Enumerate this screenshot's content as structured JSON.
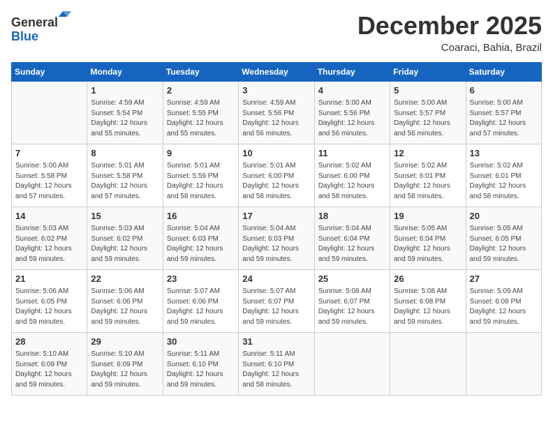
{
  "header": {
    "logo_line1": "General",
    "logo_line2": "Blue",
    "month": "December 2025",
    "location": "Coaraci, Bahia, Brazil"
  },
  "days_of_week": [
    "Sunday",
    "Monday",
    "Tuesday",
    "Wednesday",
    "Thursday",
    "Friday",
    "Saturday"
  ],
  "weeks": [
    [
      {
        "day": "",
        "info": ""
      },
      {
        "day": "1",
        "info": "Sunrise: 4:59 AM\nSunset: 5:54 PM\nDaylight: 12 hours\nand 55 minutes."
      },
      {
        "day": "2",
        "info": "Sunrise: 4:59 AM\nSunset: 5:55 PM\nDaylight: 12 hours\nand 55 minutes."
      },
      {
        "day": "3",
        "info": "Sunrise: 4:59 AM\nSunset: 5:56 PM\nDaylight: 12 hours\nand 56 minutes."
      },
      {
        "day": "4",
        "info": "Sunrise: 5:00 AM\nSunset: 5:56 PM\nDaylight: 12 hours\nand 56 minutes."
      },
      {
        "day": "5",
        "info": "Sunrise: 5:00 AM\nSunset: 5:57 PM\nDaylight: 12 hours\nand 56 minutes."
      },
      {
        "day": "6",
        "info": "Sunrise: 5:00 AM\nSunset: 5:57 PM\nDaylight: 12 hours\nand 57 minutes."
      }
    ],
    [
      {
        "day": "7",
        "info": ""
      },
      {
        "day": "8",
        "info": "Sunrise: 5:01 AM\nSunset: 5:58 PM\nDaylight: 12 hours\nand 57 minutes."
      },
      {
        "day": "9",
        "info": "Sunrise: 5:01 AM\nSunset: 5:59 PM\nDaylight: 12 hours\nand 58 minutes."
      },
      {
        "day": "10",
        "info": "Sunrise: 5:01 AM\nSunset: 6:00 PM\nDaylight: 12 hours\nand 58 minutes."
      },
      {
        "day": "11",
        "info": "Sunrise: 5:02 AM\nSunset: 6:00 PM\nDaylight: 12 hours\nand 58 minutes."
      },
      {
        "day": "12",
        "info": "Sunrise: 5:02 AM\nSunset: 6:01 PM\nDaylight: 12 hours\nand 58 minutes."
      },
      {
        "day": "13",
        "info": "Sunrise: 5:02 AM\nSunset: 6:01 PM\nDaylight: 12 hours\nand 58 minutes."
      }
    ],
    [
      {
        "day": "14",
        "info": ""
      },
      {
        "day": "15",
        "info": "Sunrise: 5:03 AM\nSunset: 6:02 PM\nDaylight: 12 hours\nand 59 minutes."
      },
      {
        "day": "16",
        "info": "Sunrise: 5:04 AM\nSunset: 6:03 PM\nDaylight: 12 hours\nand 59 minutes."
      },
      {
        "day": "17",
        "info": "Sunrise: 5:04 AM\nSunset: 6:03 PM\nDaylight: 12 hours\nand 59 minutes."
      },
      {
        "day": "18",
        "info": "Sunrise: 5:04 AM\nSunset: 6:04 PM\nDaylight: 12 hours\nand 59 minutes."
      },
      {
        "day": "19",
        "info": "Sunrise: 5:05 AM\nSunset: 6:04 PM\nDaylight: 12 hours\nand 59 minutes."
      },
      {
        "day": "20",
        "info": "Sunrise: 5:05 AM\nSunset: 6:05 PM\nDaylight: 12 hours\nand 59 minutes."
      }
    ],
    [
      {
        "day": "21",
        "info": ""
      },
      {
        "day": "22",
        "info": "Sunrise: 5:06 AM\nSunset: 6:06 PM\nDaylight: 12 hours\nand 59 minutes."
      },
      {
        "day": "23",
        "info": "Sunrise: 5:07 AM\nSunset: 6:06 PM\nDaylight: 12 hours\nand 59 minutes."
      },
      {
        "day": "24",
        "info": "Sunrise: 5:07 AM\nSunset: 6:07 PM\nDaylight: 12 hours\nand 59 minutes."
      },
      {
        "day": "25",
        "info": "Sunrise: 5:08 AM\nSunset: 6:07 PM\nDaylight: 12 hours\nand 59 minutes."
      },
      {
        "day": "26",
        "info": "Sunrise: 5:08 AM\nSunset: 6:08 PM\nDaylight: 12 hours\nand 59 minutes."
      },
      {
        "day": "27",
        "info": "Sunrise: 5:09 AM\nSunset: 6:08 PM\nDaylight: 12 hours\nand 59 minutes."
      }
    ],
    [
      {
        "day": "28",
        "info": "Sunrise: 5:10 AM\nSunset: 6:09 PM\nDaylight: 12 hours\nand 59 minutes."
      },
      {
        "day": "29",
        "info": "Sunrise: 5:10 AM\nSunset: 6:09 PM\nDaylight: 12 hours\nand 59 minutes."
      },
      {
        "day": "30",
        "info": "Sunrise: 5:11 AM\nSunset: 6:10 PM\nDaylight: 12 hours\nand 59 minutes."
      },
      {
        "day": "31",
        "info": "Sunrise: 5:11 AM\nSunset: 6:10 PM\nDaylight: 12 hours\nand 58 minutes."
      },
      {
        "day": "",
        "info": ""
      },
      {
        "day": "",
        "info": ""
      },
      {
        "day": "",
        "info": ""
      }
    ]
  ],
  "week7_sunday": "Sunrise: 5:00 AM\nSunset: 5:58 PM\nDaylight: 12 hours\nand 57 minutes.",
  "week3_sunday": "Sunrise: 5:03 AM\nSunset: 6:02 PM\nDaylight: 12 hours\nand 59 minutes.",
  "week4_sunday": "Sunrise: 5:06 AM\nSunset: 6:05 PM\nDaylight: 12 hours\nand 59 minutes."
}
